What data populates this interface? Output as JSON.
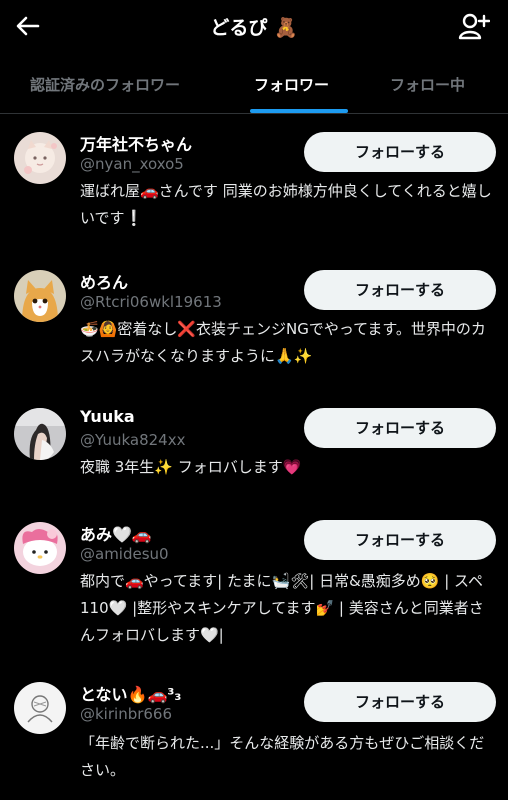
{
  "header": {
    "title": "どるぴ 🧸"
  },
  "tabs": [
    {
      "label": "認証済みのフォロワー"
    },
    {
      "label": "フォロワー"
    },
    {
      "label": "フォロー中"
    }
  ],
  "follow_label": "フォローする",
  "users": [
    {
      "name": "万年社不ちゃん",
      "handle": "@nyan_xoxo5",
      "bio": "運ばれ屋🚗さんです 同業のお姉様方仲良くしてくれると嬉しいです❕"
    },
    {
      "name": "めろん",
      "handle": "@Rtcri06wkl19613",
      "bio": "🍜🙆密着なし❌衣装チェンジNGでやってます。世界中のカスハラがなくなりますように🙏✨"
    },
    {
      "name": "Yuuka",
      "handle": "@Yuuka824xx",
      "bio": "夜職 3年生✨ フォロバします💗"
    },
    {
      "name": "あみ🤍🚗",
      "handle": "@amidesu0",
      "bio": "都内で🚗やってます| たまに🛀🛠| 日常&愚痴多め🥺 | スペ110🤍 |整形やスキンケアしてます💅 | 美容さんと同業者さんフォロバします🤍|"
    },
    {
      "name": "とない🔥🚗³₃",
      "handle": "@kirinbr666",
      "bio": "「年齢で断られた...」そんな経験がある方もぜひご相談ください。"
    }
  ]
}
